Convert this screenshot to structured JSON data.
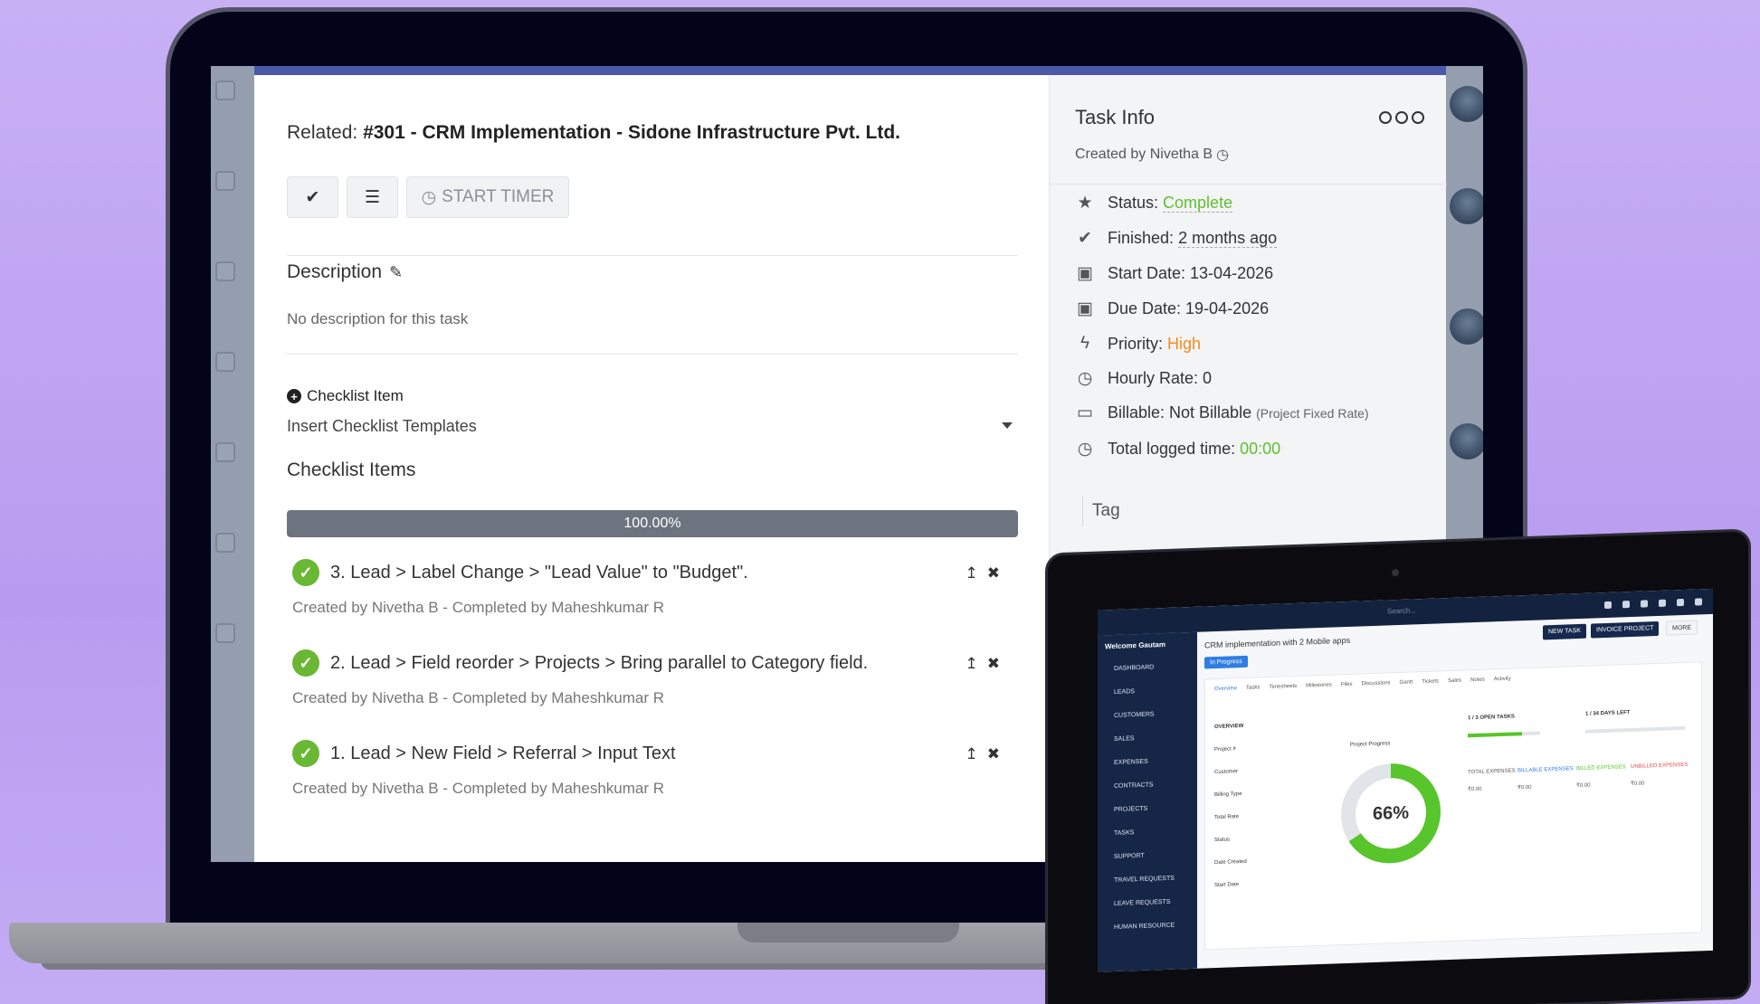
{
  "modal": {
    "related_label": "Related:",
    "related_value": "#301 - CRM Implementation - Sidone Infrastructure Pvt. Ltd.",
    "start_timer_label": "START TIMER",
    "description_title": "Description",
    "description_text": "No description for this task",
    "checklist_add_label": "Checklist Item",
    "insert_templates_label": "Insert Checklist Templates",
    "checklist_items_title": "Checklist Items",
    "progress_text": "100.00%",
    "progress_value": 100,
    "items": [
      {
        "text": "3. Lead > Label Change > \"Lead Value\" to \"Budget\".",
        "meta": "Created by Nivetha B - Completed by Maheshkumar R"
      },
      {
        "text": "2. Lead > Field reorder > Projects > Bring parallel to Category field.",
        "meta": "Created by Nivetha B - Completed by Maheshkumar R"
      },
      {
        "text": "1. Lead > New Field > Referral > Input Text",
        "meta": "Created by Nivetha B - Completed by Maheshkumar R"
      }
    ]
  },
  "task_info": {
    "title": "Task Info",
    "created_by": "Created by Nivetha B",
    "status_label": "Status:",
    "status_value": "Complete",
    "finished_label": "Finished:",
    "finished_value": "2 months ago",
    "start_date": "Start Date: 13-04-2026",
    "due_date": "Due Date: 19-04-2026",
    "priority_label": "Priority:",
    "priority_value": "High",
    "hourly_rate": "Hourly Rate: 0",
    "billable_label": "Billable: Not Billable",
    "billable_note": "(Project Fixed Rate)",
    "total_logged_label": "Total logged time:",
    "total_logged_value": "00:00",
    "tag_label": "Tag"
  },
  "colors": {
    "accent_green": "#5fbf2d",
    "priority_orange": "#f28b1d",
    "progress_bar": "#6c747f",
    "header_accent": "#4a5aa8"
  },
  "tablet": {
    "search_placeholder": "Search...",
    "welcome": "Welcome Gautam",
    "menu": [
      "DASHBOARD",
      "LEADS",
      "CUSTOMERS",
      "SALES",
      "EXPENSES",
      "CONTRACTS",
      "PROJECTS",
      "TASKS",
      "SUPPORT",
      "TRAVEL REQUESTS",
      "LEAVE REQUESTS",
      "HUMAN RESOURCE"
    ],
    "project_title": "CRM implementation with 2 Mobile apps",
    "status_badge": "In Progress",
    "btn_new_task": "NEW TASK",
    "btn_invoice": "INVOICE PROJECT",
    "btn_more": "MORE",
    "tabs": [
      "Overview",
      "Tasks",
      "Timesheets",
      "Milestones",
      "Files",
      "Discussions",
      "Gantt",
      "Tickets",
      "Sales",
      "Notes",
      "Activity"
    ],
    "overview_label": "OVERVIEW",
    "project_progress_label": "Project Progress",
    "progress_percent": "66%",
    "progress_fraction": 0.66,
    "open_tasks": "1 / 3 OPEN TASKS",
    "days_left": "1 / 34 DAYS LEFT",
    "fields": [
      "Project #",
      "Customer",
      "Billing Type",
      "Total Rate",
      "Status",
      "Date Created",
      "Start Date"
    ],
    "money_labels": [
      "TOTAL EXPENSES",
      "BILLABLE EXPENSES",
      "BILLED EXPENSES",
      "UNBILLED EXPENSES"
    ],
    "money_values": [
      "₹0.00",
      "₹0.00",
      "₹0.00",
      "₹0.00"
    ]
  }
}
